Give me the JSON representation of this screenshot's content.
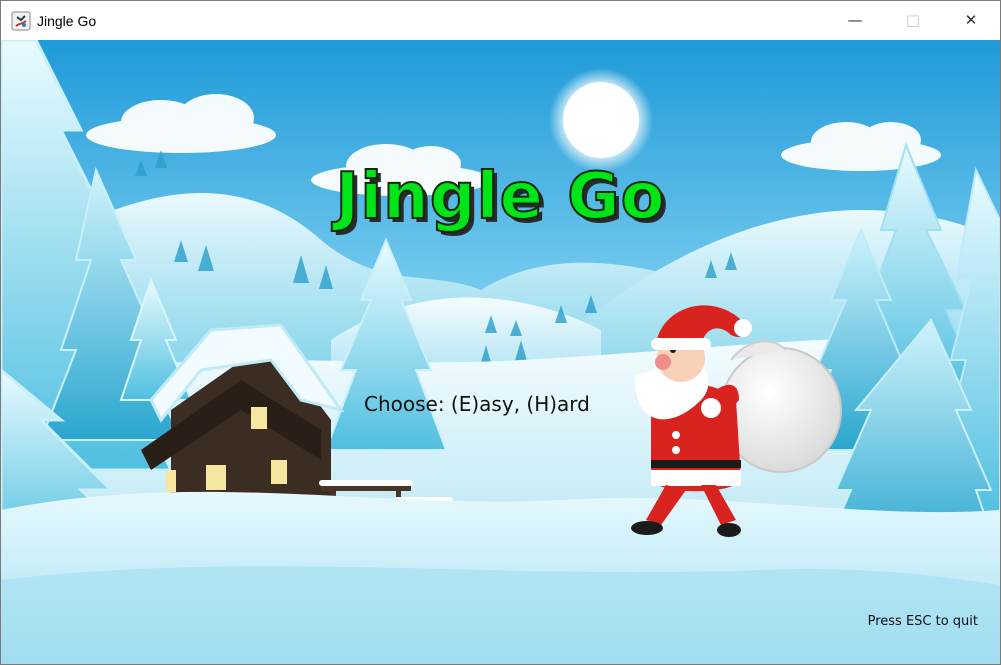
{
  "window": {
    "title": "Jingle Go",
    "controls": {
      "minimize_icon": "minimize-icon",
      "maximize_icon": "maximize-icon",
      "close_icon": "close-icon"
    }
  },
  "game": {
    "title": "Jingle Go",
    "prompt": "Choose: (E)asy, (H)ard",
    "quit_hint": "Press ESC to quit",
    "colors": {
      "title_fill": "#00e51a",
      "title_shadow": "#2a2a2a",
      "sky_top": "#35a8df",
      "snow": "#e8f8fc"
    }
  }
}
